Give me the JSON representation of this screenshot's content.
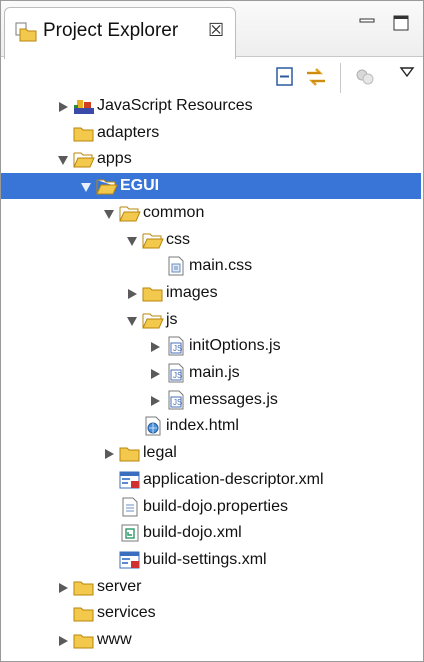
{
  "view": {
    "title": "Project Explorer",
    "close_glyph": "☒"
  },
  "icons": {
    "view_icon": "project-explorer-icon",
    "minimize": "minimize-icon",
    "maximize": "maximize-icon",
    "collapse_all": "collapse-all-icon",
    "link_editor": "link-with-editor-icon",
    "filter": "filter-icon",
    "view_menu": "view-menu-icon"
  },
  "colors": {
    "selection": "#3875d7",
    "folder": "#f2c94c",
    "folder_stroke": "#b8860b"
  },
  "tree": {
    "items": [
      {
        "label": "JavaScript Resources",
        "type": "jsresources",
        "expander": "collapsed",
        "depth": 0
      },
      {
        "label": "adapters",
        "type": "folder",
        "expander": "none",
        "depth": 0
      },
      {
        "label": "apps",
        "type": "folder-open",
        "expander": "expanded",
        "depth": 0
      },
      {
        "label": "EGUI",
        "type": "folder-open",
        "expander": "expanded",
        "depth": 1,
        "selected": true
      },
      {
        "label": "common",
        "type": "folder-open",
        "expander": "expanded",
        "depth": 2
      },
      {
        "label": "css",
        "type": "folder-open",
        "expander": "expanded",
        "depth": 3
      },
      {
        "label": "main.css",
        "type": "css-file",
        "expander": "none",
        "depth": 4
      },
      {
        "label": "images",
        "type": "folder",
        "expander": "collapsed",
        "depth": 3
      },
      {
        "label": "js",
        "type": "folder-open",
        "expander": "expanded",
        "depth": 3
      },
      {
        "label": "initOptions.js",
        "type": "js-file",
        "expander": "collapsed",
        "depth": 4
      },
      {
        "label": "main.js",
        "type": "js-file",
        "expander": "collapsed",
        "depth": 4
      },
      {
        "label": "messages.js",
        "type": "js-file",
        "expander": "collapsed",
        "depth": 4
      },
      {
        "label": "index.html",
        "type": "html-file",
        "expander": "none",
        "depth": 3
      },
      {
        "label": "legal",
        "type": "folder",
        "expander": "collapsed",
        "depth": 2
      },
      {
        "label": "application-descriptor.xml",
        "type": "app-xml",
        "expander": "none",
        "depth": 2
      },
      {
        "label": "build-dojo.properties",
        "type": "text-file",
        "expander": "none",
        "depth": 2
      },
      {
        "label": "build-dojo.xml",
        "type": "xml-file",
        "expander": "none",
        "depth": 2
      },
      {
        "label": "build-settings.xml",
        "type": "app-xml",
        "expander": "none",
        "depth": 2
      },
      {
        "label": "server",
        "type": "folder",
        "expander": "collapsed",
        "depth": 0
      },
      {
        "label": "services",
        "type": "folder",
        "expander": "none",
        "depth": 0
      },
      {
        "label": "www",
        "type": "folder",
        "expander": "collapsed",
        "depth": 0
      }
    ]
  }
}
